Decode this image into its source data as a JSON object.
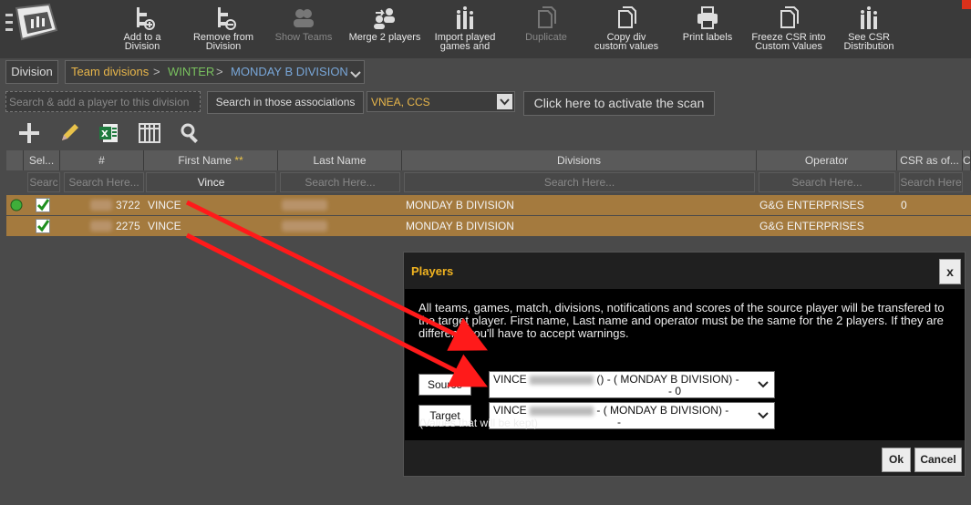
{
  "colors": {
    "accent": "#f0b320",
    "row_selected": "#a47a3e",
    "breadcrumb_orange": "#e8b64a",
    "breadcrumb_green": "#79c15f",
    "breadcrumb_blue": "#79a7d9",
    "annotation_arrow": "#ff1a1a"
  },
  "toolbar": {
    "add_to_division": "Add to a\nDivision",
    "remove_from_division": "Remove from\nDivision",
    "show_teams": "Show Teams",
    "merge_2_players": "Merge 2 players",
    "import_played": "Import played\ngames and",
    "duplicate": "Duplicate",
    "copy_div": "Copy div\ncustom values",
    "print_labels": "Print labels",
    "freeze_csr": "Freeze CSR into\nCustom Values",
    "see_csr": "See CSR\nDistribution"
  },
  "breadcrumb": {
    "division_button": "Division",
    "team_divisions": "Team divisions",
    "winter": "WINTER",
    "monday_b": "MONDAY B DIVISION",
    "sep": ">"
  },
  "search": {
    "add_placeholder": "Search & add a player to this division",
    "assoc_label": "Search in those associations",
    "assoc_value": "VNEA, CCS",
    "scan_button": "Click here to activate the scan"
  },
  "grid": {
    "headers": {
      "sel": "Sel...",
      "num": "#",
      "first_name": "First Name",
      "first_name_mark": "**",
      "last_name": "Last Name",
      "divisions": "Divisions",
      "operator": "Operator",
      "csr": "CSR as of...",
      "c": "C"
    },
    "filters": {
      "sel": "Searc",
      "num": "Search Here...",
      "first_name": "Vince",
      "last_name": "Search Here...",
      "divisions": "Search Here...",
      "operator": "Search Here...",
      "csr": "Search Here"
    },
    "rows": [
      {
        "num": "3722",
        "first": "VINCE",
        "division": "MONDAY B DIVISION",
        "operator": "G&G ENTERPRISES",
        "csr": "0"
      },
      {
        "num": "2275",
        "first": "VINCE",
        "division": "MONDAY B DIVISION",
        "operator": "G&G ENTERPRISES",
        "csr": ""
      }
    ]
  },
  "modal": {
    "title": "Players",
    "close": "x",
    "message": "All teams, games, match, divisions, notifications and scores of the source player will be transfered to the target player. First name, Last name and operator must be the same for the 2 players. If they are different, you'll have to accept warnings.",
    "source_label": "Source",
    "target_label": "Target",
    "source_name": "VINCE",
    "source_rest": "() - ( MONDAY B DIVISION) -",
    "source_line2": "- 0",
    "target_name": "VINCE",
    "target_rest": "- ( MONDAY B DIVISION) -",
    "target_line2": "-",
    "values_kept": "(Values that will be kept)",
    "ok": "Ok",
    "cancel": "Cancel"
  }
}
